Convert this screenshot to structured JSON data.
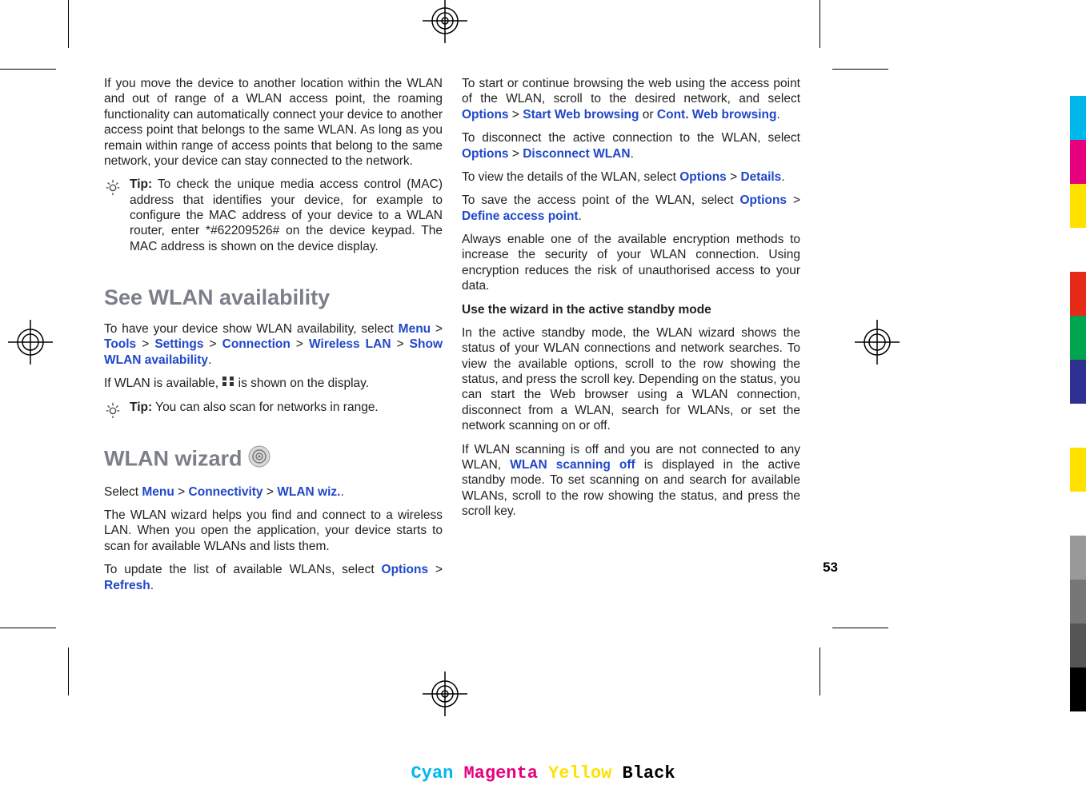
{
  "pageNumber": "53",
  "col1": {
    "p1": "If you move the device to another location within the WLAN and out of range of a WLAN access point, the roaming functionality can automatically connect your device to another access point that belongs to the same WLAN. As long as you remain within range of access points that belong to the same network, your device can stay connected to the network.",
    "tip1_label": "Tip:",
    "tip1_text": " To check the unique media access control (MAC) address that identifies your device, for example to configure the MAC address of your device to a WLAN router, enter *#62209526# on the device keypad. The MAC address is shown on the device display.",
    "h1": "See WLAN availability",
    "p2a": "To have your device show WLAN availability, select ",
    "nav1": {
      "menu": "Menu",
      "tools": "Tools",
      "settings": "Settings",
      "connection": "Connection",
      "wlan": "Wireless LAN",
      "show": "Show WLAN availability"
    },
    "p3a": "If WLAN is available, ",
    "p3b": " is shown on the display.",
    "tip2_label": "Tip:",
    "tip2_text": " You can also scan for networks in range.",
    "h2": "WLAN wizard",
    "p4a": "Select ",
    "nav2": {
      "menu": "Menu",
      "conn": "Connectivity",
      "wiz": "WLAN wiz."
    },
    "p5": "The WLAN wizard helps you find and connect to a wireless LAN. When you open the application, your device starts to scan for available WLANs and lists them.",
    "p6a": "To update the list of available WLANs, select ",
    "p6b": "Options",
    "p6c": "Refresh"
  },
  "col2": {
    "p1a": "To start or continue browsing the web using the access point of the WLAN, scroll to the desired network, and select ",
    "p1_opt": "Options",
    "p1_start": "Start Web browsing",
    "p1_or": " or ",
    "p1_cont": "Cont. Web browsing",
    "p2a": "To disconnect the active connection to the WLAN, select ",
    "p2_opt": "Options",
    "p2_disc": "Disconnect WLAN",
    "p3a": "To view the details of the WLAN, select ",
    "p3_opt": "Options",
    "p3_det": "Details",
    "p4a": "To save the access point of the WLAN, select ",
    "p4_opt": "Options",
    "p4_def": "Define access point",
    "p5": "Always enable one of the available encryption methods to increase the security of your WLAN connection. Using encryption reduces the risk of unauthorised access to your data.",
    "h3": "Use the wizard in the active standby mode",
    "p6": "In the active standby mode, the WLAN wizard shows the status of your WLAN connections and network searches. To view the available options, scroll to the row showing the status, and press the scroll key. Depending on the status, you can start the Web browser using a WLAN connection, disconnect from a WLAN, search for WLANs, or set the network scanning on or off.",
    "p7a": "If WLAN scanning is off and you are not connected to any WLAN, ",
    "p7_off": "WLAN scanning off",
    "p7b": " is displayed in the active standby mode. To set scanning on and search for available WLANs, scroll to the row showing the status, and press the scroll key."
  },
  "gt": " > ",
  "cmyk": {
    "c": "Cyan",
    "m": "Magenta",
    "y": "Yellow",
    "k": "Black"
  }
}
